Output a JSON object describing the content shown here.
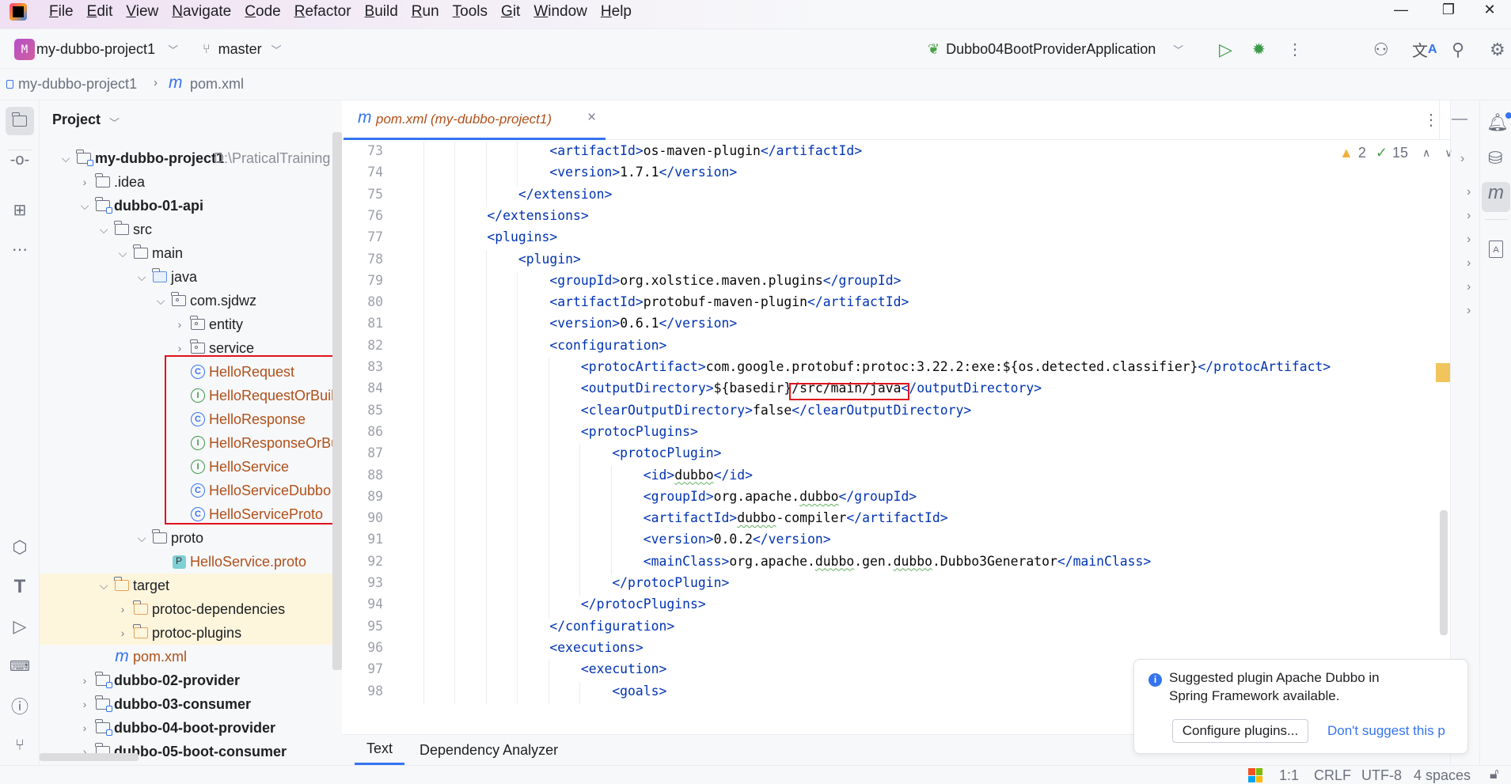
{
  "colors": {
    "accent": "#3574f0",
    "tag": "#0033b3",
    "modified_file": "#b0501a",
    "highlight_box": "#e0121e",
    "excluded_folder_bg": "#fdf5dc"
  },
  "menu": [
    "File",
    "Edit",
    "View",
    "Navigate",
    "Code",
    "Refactor",
    "Build",
    "Run",
    "Tools",
    "Git",
    "Window",
    "Help"
  ],
  "window_controls": {
    "minimize": "—",
    "restore": "❐",
    "close": "✕"
  },
  "toolbar": {
    "project_badge": "M",
    "project_name": "my-dubbo-project1",
    "branch": "master",
    "run_config": "Dubbo04BootProviderApplication"
  },
  "breadcrumb": {
    "project": "my-dubbo-project1",
    "file": "pom.xml",
    "file_icon": "m"
  },
  "project_panel": {
    "title": "Project",
    "rows": [
      {
        "label": "my-dubbo-project1",
        "hint": "D:\\PraticalTraining",
        "level": 0,
        "chevron": "open",
        "icon": "module",
        "bold": true
      },
      {
        "label": ".idea",
        "level": 1,
        "chevron": "closed",
        "icon": "folder"
      },
      {
        "label": "dubbo-01-api",
        "level": 1,
        "chevron": "open",
        "icon": "module",
        "bold": true
      },
      {
        "label": "src",
        "level": 2,
        "chevron": "open",
        "icon": "folder"
      },
      {
        "label": "main",
        "level": 3,
        "chevron": "open",
        "icon": "folder"
      },
      {
        "label": "java",
        "level": 4,
        "chevron": "open",
        "icon": "source-folder"
      },
      {
        "label": "com.sjdwz",
        "level": 5,
        "chevron": "open",
        "icon": "package"
      },
      {
        "label": "entity",
        "level": 6,
        "chevron": "closed",
        "icon": "package"
      },
      {
        "label": "service",
        "level": 6,
        "chevron": "closed",
        "icon": "package"
      },
      {
        "label": "HelloRequest",
        "level": 6,
        "icon": "class",
        "modified": true
      },
      {
        "label": "HelloRequestOrBuild",
        "level": 6,
        "icon": "interface",
        "modified": true
      },
      {
        "label": "HelloResponse",
        "level": 6,
        "icon": "class",
        "modified": true
      },
      {
        "label": "HelloResponseOrBuil",
        "level": 6,
        "icon": "interface",
        "modified": true
      },
      {
        "label": "HelloService",
        "level": 6,
        "icon": "interface",
        "modified": true
      },
      {
        "label": "HelloServiceDubbo",
        "level": 6,
        "icon": "class",
        "modified": true
      },
      {
        "label": "HelloServiceProto",
        "level": 6,
        "icon": "class",
        "modified": true
      },
      {
        "label": "proto",
        "level": 4,
        "chevron": "open",
        "icon": "folder"
      },
      {
        "label": "HelloService.proto",
        "level": 5,
        "icon": "proto-file",
        "modified": true
      },
      {
        "label": "target",
        "level": 2,
        "chevron": "open",
        "icon": "excluded-folder",
        "excluded": true
      },
      {
        "label": "protoc-dependencies",
        "level": 3,
        "chevron": "closed",
        "icon": "excluded-folder",
        "excluded": true
      },
      {
        "label": "protoc-plugins",
        "level": 3,
        "chevron": "closed",
        "icon": "excluded-folder",
        "excluded": true
      },
      {
        "label": "pom.xml",
        "level": 2,
        "icon": "maven-file",
        "modified": true
      },
      {
        "label": "dubbo-02-provider",
        "level": 1,
        "chevron": "closed",
        "icon": "module",
        "bold": true
      },
      {
        "label": "dubbo-03-consumer",
        "level": 1,
        "chevron": "closed",
        "icon": "module",
        "bold": true
      },
      {
        "label": "dubbo-04-boot-provider",
        "level": 1,
        "chevron": "closed",
        "icon": "module",
        "bold": true
      },
      {
        "label": "dubbo-05-boot-consumer",
        "level": 1,
        "chevron": "closed",
        "icon": "module",
        "bold": true
      }
    ]
  },
  "editor": {
    "tab": {
      "icon": "m",
      "label": "pom.xml (my-dubbo-project1)",
      "close": "×"
    },
    "inspections": {
      "warnings": "2",
      "weak_warnings": "15"
    },
    "spellcheck_flagged": [
      "dubbo"
    ],
    "lines": [
      {
        "n": "73",
        "text": "                    <artifactId>os-maven-plugin</artifactId>"
      },
      {
        "n": "74",
        "text": "                    <version>1.7.1</version>"
      },
      {
        "n": "75",
        "text": "                </extension>"
      },
      {
        "n": "76",
        "text": "            </extensions>"
      },
      {
        "n": "77",
        "text": "            <plugins>"
      },
      {
        "n": "78",
        "text": "                <plugin>"
      },
      {
        "n": "79",
        "text": "                    <groupId>org.xolstice.maven.plugins</groupId>"
      },
      {
        "n": "80",
        "text": "                    <artifactId>protobuf-maven-plugin</artifactId>"
      },
      {
        "n": "81",
        "text": "                    <version>0.6.1</version>"
      },
      {
        "n": "82",
        "text": "                    <configuration>"
      },
      {
        "n": "83",
        "text": "                        <protocArtifact>com.google.protobuf:protoc:3.22.2:exe:${os.detected.classifier}</protocArtifact>"
      },
      {
        "n": "84",
        "text": "                        <outputDirectory>${basedir}/src/main/java</outputDirectory>"
      },
      {
        "n": "85",
        "text": "                        <clearOutputDirectory>false</clearOutputDirectory>"
      },
      {
        "n": "86",
        "text": "                        <protocPlugins>"
      },
      {
        "n": "87",
        "text": "                            <protocPlugin>"
      },
      {
        "n": "88",
        "text": "                                <id>dubbo</id>"
      },
      {
        "n": "89",
        "text": "                                <groupId>org.apache.dubbo</groupId>"
      },
      {
        "n": "90",
        "text": "                                <artifactId>dubbo-compiler</artifactId>"
      },
      {
        "n": "91",
        "text": "                                <version>0.0.2</version>"
      },
      {
        "n": "92",
        "text": "                                <mainClass>org.apache.dubbo.gen.dubbo.Dubbo3Generator</mainClass>"
      },
      {
        "n": "93",
        "text": "                            </protocPlugin>"
      },
      {
        "n": "94",
        "text": "                        </protocPlugins>"
      },
      {
        "n": "95",
        "text": "                    </configuration>"
      },
      {
        "n": "96",
        "text": "                    <executions>"
      },
      {
        "n": "97",
        "text": "                        <execution>"
      },
      {
        "n": "98",
        "text": "                            <goals>"
      }
    ],
    "bottom_tabs": [
      {
        "label": "Text",
        "active": true
      },
      {
        "label": "Dependency Analyzer",
        "active": false
      }
    ]
  },
  "notification": {
    "message_line1": "Suggested plugin Apache Dubbo in",
    "message_line2": "Spring Framework available.",
    "primary_action": "Configure plugins...",
    "secondary_action": "Don't suggest this p"
  },
  "status_bar": {
    "position": "1:1",
    "line_separator": "CRLF",
    "encoding": "UTF-8",
    "indent": "4 spaces"
  }
}
